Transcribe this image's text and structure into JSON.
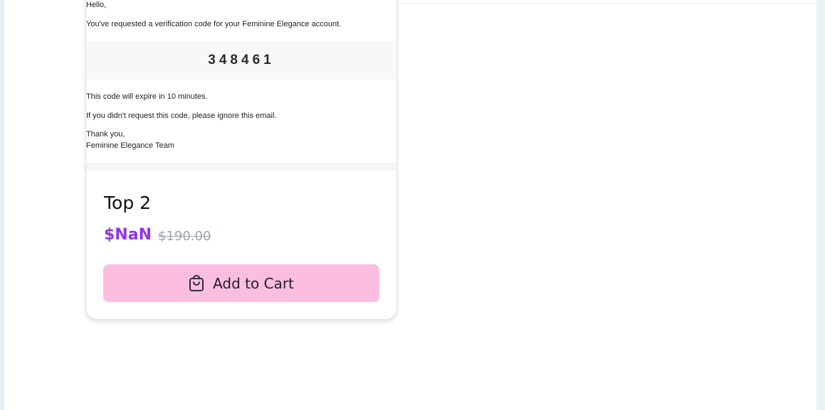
{
  "email": {
    "greeting": "Hello,",
    "intro": "You've requested a verification code for your Feminine Elegance account.",
    "code": "348461",
    "expiry": "This code will expire in 10 minutes.",
    "ignore_note": "If you didn't request this code, please ignore this email.",
    "sign_off": "Thank you,",
    "team": "Feminine Elegance Team"
  },
  "product": {
    "title": "Top 2",
    "price": "$NaN",
    "original_price": "$190.00",
    "add_to_cart_label": "Add to Cart",
    "cart_icon": "shopping-bag-icon"
  },
  "colors": {
    "price": "#9333ea",
    "button_bg": "#fbbde0",
    "original_price": "#9ca3af"
  }
}
